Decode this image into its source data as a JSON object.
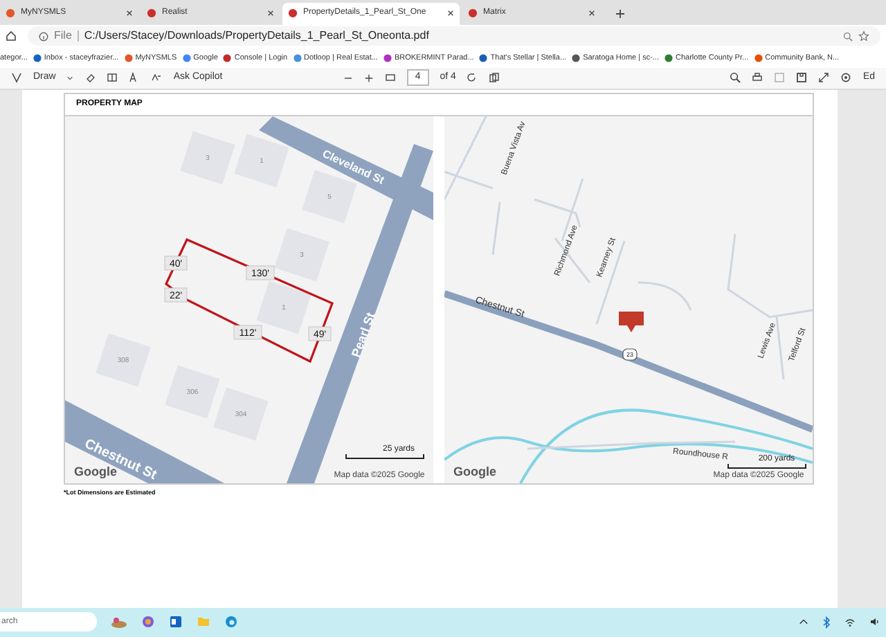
{
  "tabs": [
    {
      "label": "MyNYSMLS",
      "selected": false,
      "color": "#e2572b"
    },
    {
      "label": "Realist",
      "selected": false,
      "color": "#c8302c"
    },
    {
      "label": "PropertyDetails_1_Pearl_St_One",
      "selected": true,
      "color": "#c8302c"
    },
    {
      "label": "Matrix",
      "selected": false,
      "color": "#c8302c"
    }
  ],
  "address_bar": {
    "scheme": "File",
    "url": "C:/Users/Stacey/Downloads/PropertyDetails_1_Pearl_St_Oneonta.pdf"
  },
  "bookmarks": [
    {
      "label": "ategor..."
    },
    {
      "label": "Inbox - staceyfrazier..."
    },
    {
      "label": "MyNYSMLS"
    },
    {
      "label": "Google"
    },
    {
      "label": "Console | Login"
    },
    {
      "label": "Dotloop | Real Estat..."
    },
    {
      "label": "BROKERMINT Parad..."
    },
    {
      "label": "That's Stellar | Stella..."
    },
    {
      "label": "Saratoga Home | sc-..."
    },
    {
      "label": "Charlotte County Pr..."
    },
    {
      "label": "Community Bank, N..."
    }
  ],
  "pdf_toolbar": {
    "draw": "Draw",
    "ask": "Ask Copilot",
    "page": "4",
    "of": "of 4",
    "edge_label": "Ed"
  },
  "section_title": "PROPERTY MAP",
  "parcel_map": {
    "streets": [
      "Cleveland St",
      "Pearl St",
      "Chestnut St"
    ],
    "buildings": [
      "3",
      "1",
      "5",
      "3",
      "1",
      "308",
      "306",
      "304"
    ],
    "lot_dimensions": [
      "40'",
      "130'",
      "22'",
      "112'",
      "49'"
    ],
    "scale": "25 yards",
    "attribution": "Map data ©2025 Google",
    "logo": "Google"
  },
  "area_map": {
    "streets": [
      "Buena Vista Av",
      "Richmond Ave",
      "Kearney St",
      "Chestnut St",
      "Lewis Ave",
      "Telford St",
      "Roundhouse R"
    ],
    "route": "23",
    "scale": "200 yards",
    "attribution": "Map data ©2025 Google",
    "logo": "Google"
  },
  "footnote": "*Lot Dimensions are Estimated",
  "taskbar": {
    "search": "arch"
  }
}
